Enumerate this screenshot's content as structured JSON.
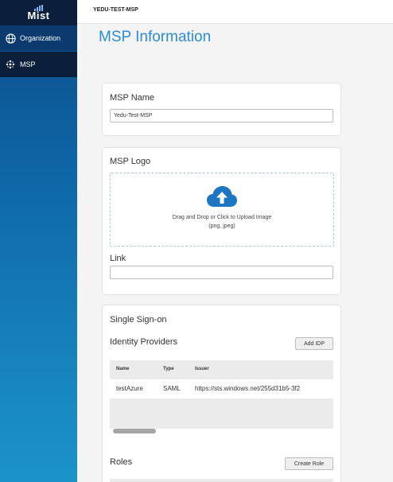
{
  "sidebar": {
    "logo": "Mist",
    "items": [
      {
        "label": "Organization",
        "icon": "globe-icon"
      },
      {
        "label": "MSP",
        "icon": "msp-dots-icon"
      }
    ]
  },
  "topbar": {
    "org_name": "YEDU-TEST-MSP"
  },
  "page": {
    "title": "MSP Information"
  },
  "msp_name": {
    "title": "MSP Name",
    "value": "Yedu-Test-MSP"
  },
  "msp_logo": {
    "title": "MSP Logo",
    "upload_line1": "Drag and Drop or Click to Upload Image",
    "upload_line2": "(png, jpeg)",
    "upload_icon": "cloud-upload-icon",
    "link_label": "Link",
    "link_value": ""
  },
  "sso": {
    "title": "Single Sign-on",
    "idp_title": "Identity Providers",
    "add_idp_label": "Add IDP",
    "columns": [
      "Name",
      "Type",
      "Issuer"
    ],
    "rows": [
      {
        "name": "testAzure",
        "type": "SAML",
        "issuer": "https://sts.windows.net/255d31b5-3f2"
      }
    ],
    "roles_title": "Roles",
    "create_role_label": "Create Role"
  },
  "colors": {
    "accent": "#2d8bd6",
    "sidebar_dark": "#0b1f3a",
    "upload_icon": "#1d76c2"
  }
}
